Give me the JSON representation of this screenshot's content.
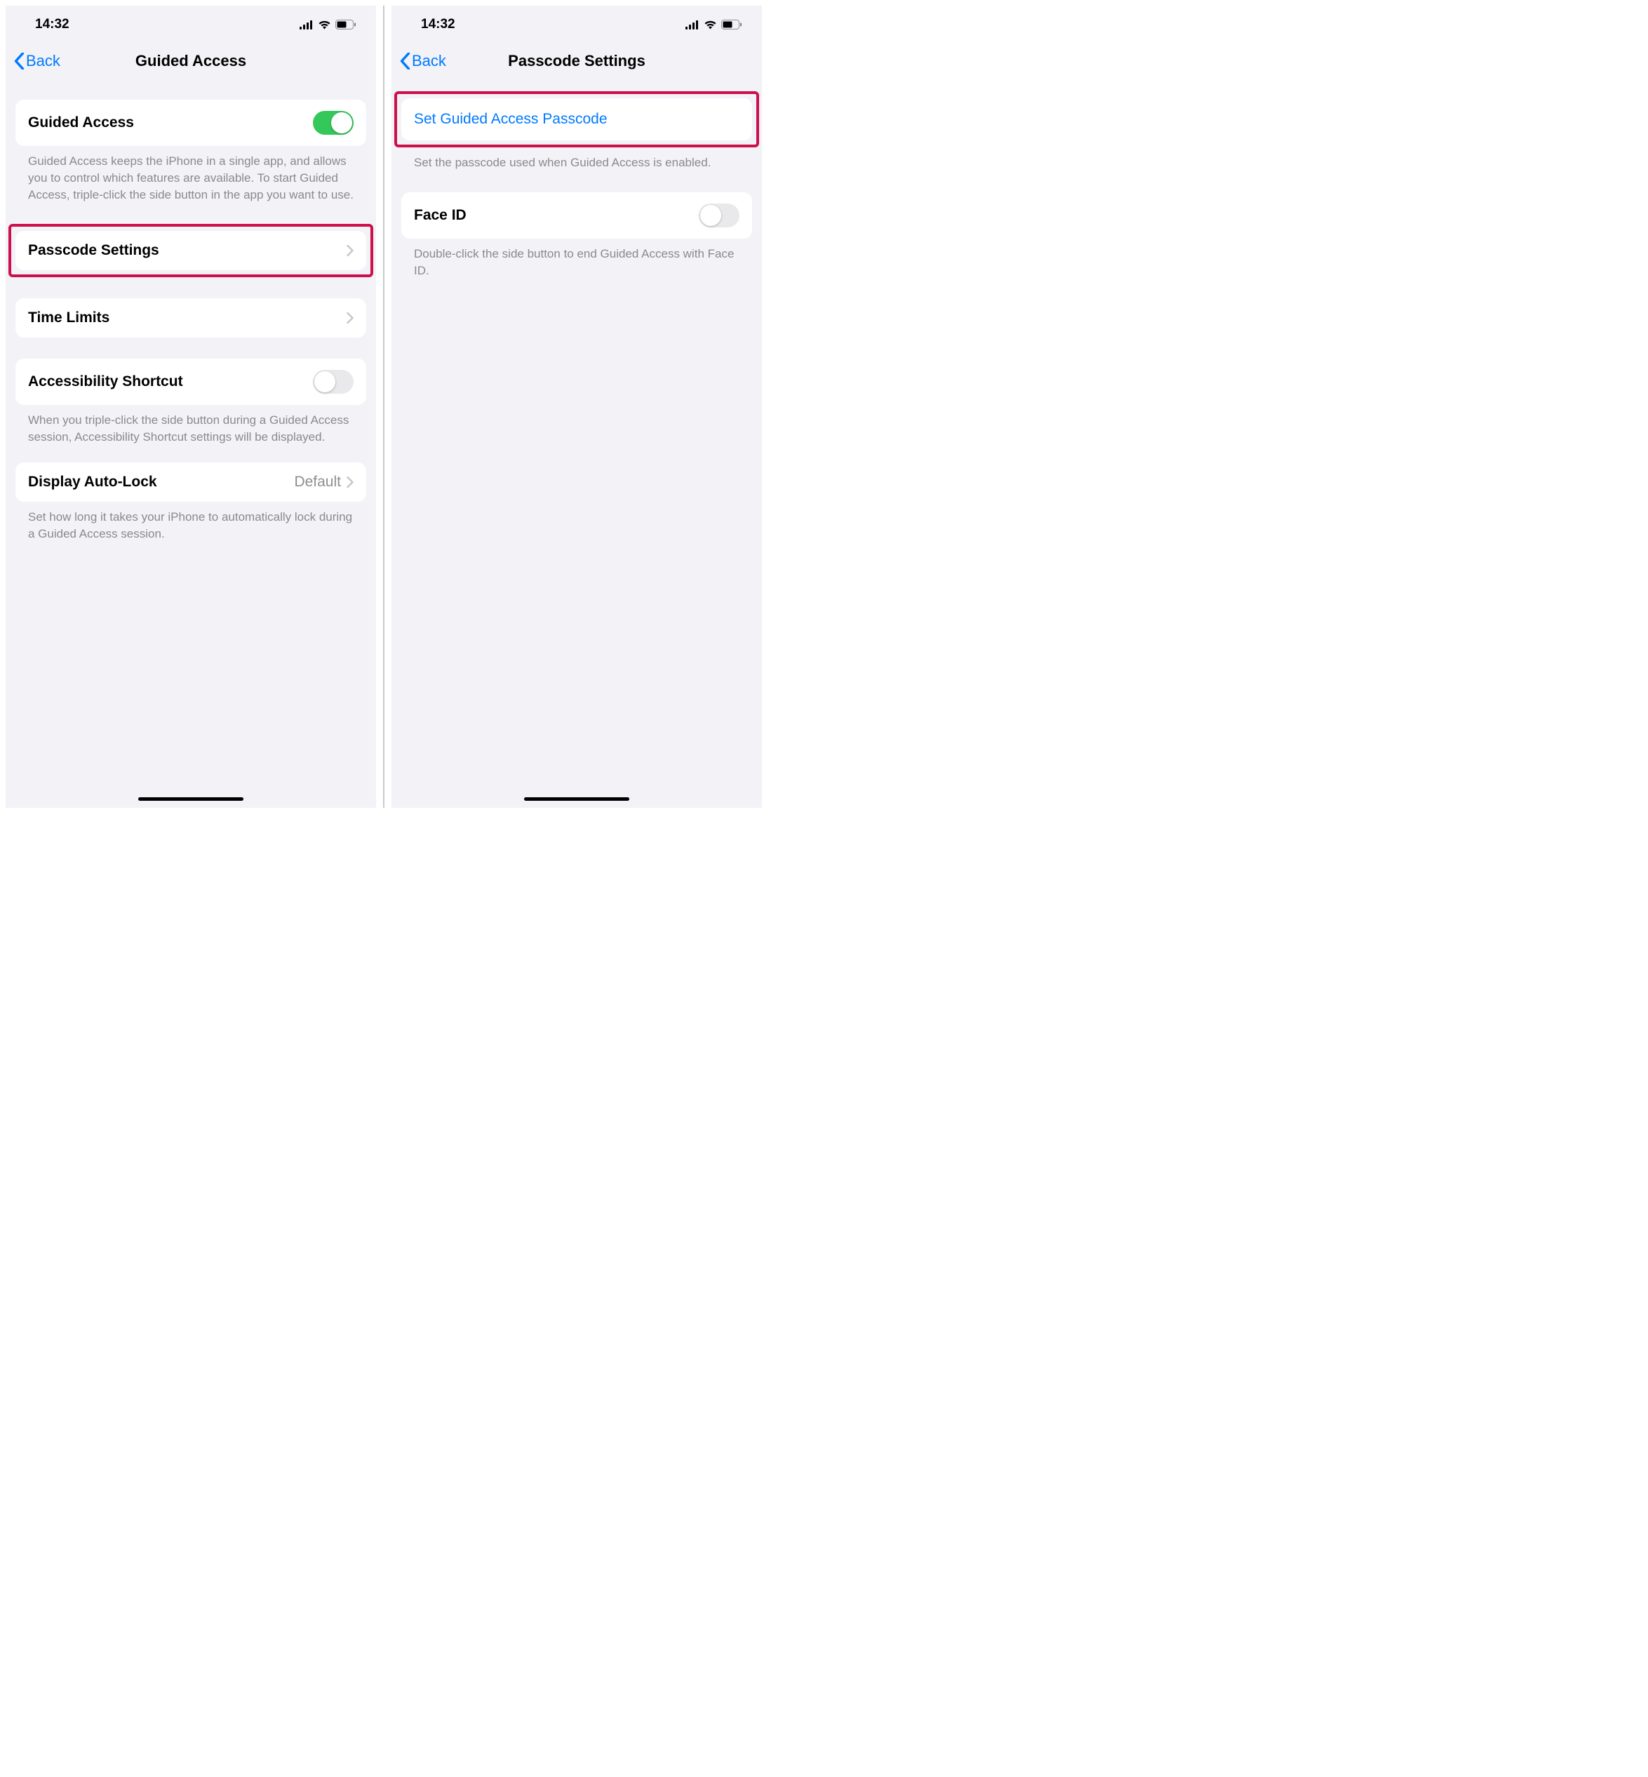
{
  "status": {
    "time": "14:32"
  },
  "left": {
    "back": "Back",
    "title": "Guided Access",
    "guided_access_label": "Guided Access",
    "guided_access_desc": "Guided Access keeps the iPhone in a single app, and allows you to control which features are available. To start Guided Access, triple-click the side button in the app you want to use.",
    "passcode_settings": "Passcode Settings",
    "time_limits": "Time Limits",
    "accessibility_shortcut": "Accessibility Shortcut",
    "accessibility_desc": "When you triple-click the side button during a Guided Access session, Accessibility Shortcut settings will be displayed.",
    "display_autolock": "Display Auto-Lock",
    "display_autolock_value": "Default",
    "display_autolock_desc": "Set how long it takes your iPhone to automatically lock during a Guided Access session."
  },
  "right": {
    "back": "Back",
    "title": "Passcode Settings",
    "set_passcode": "Set Guided Access Passcode",
    "set_passcode_desc": "Set the passcode used when Guided Access is enabled.",
    "face_id": "Face ID",
    "face_id_desc": "Double-click the side button to end Guided Access with Face ID."
  }
}
